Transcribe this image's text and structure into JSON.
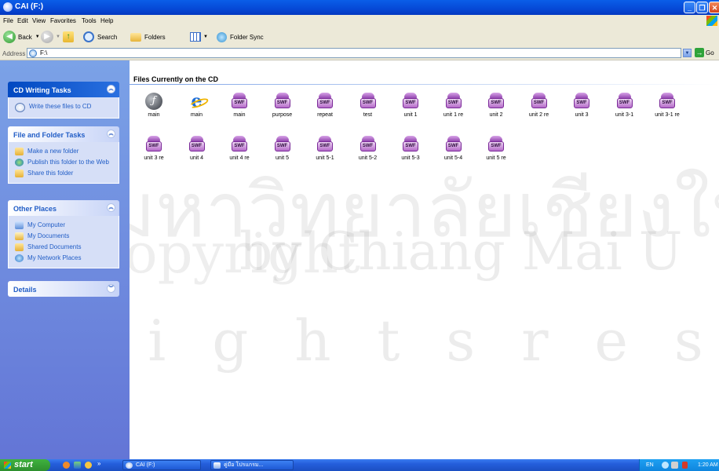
{
  "window": {
    "title": "CAI (F:)"
  },
  "menu": [
    "File",
    "Edit",
    "View",
    "Favorites",
    "Tools",
    "Help"
  ],
  "toolbar": {
    "back": "Back",
    "search": "Search",
    "folders": "Folders",
    "folder_sync": "Folder Sync"
  },
  "address": {
    "label": "Address",
    "value": "F:\\",
    "go": "Go"
  },
  "tasks": {
    "cd": {
      "title": "CD Writing Tasks",
      "items": [
        "Write these files to CD"
      ]
    },
    "file": {
      "title": "File and Folder Tasks",
      "items": [
        "Make a new folder",
        "Publish this folder to the Web",
        "Share this folder"
      ]
    },
    "places": {
      "title": "Other Places",
      "items": [
        "My Computer",
        "My Documents",
        "Shared Documents",
        "My Network Places"
      ]
    },
    "details": {
      "title": "Details"
    }
  },
  "content": {
    "section_title": "Files Currently on the CD",
    "files": [
      {
        "name": "main",
        "icon": "flash-icon"
      },
      {
        "name": "main",
        "icon": "ie-icon"
      },
      {
        "name": "main",
        "icon": "swf-icon"
      },
      {
        "name": "purpose",
        "icon": "swf-icon"
      },
      {
        "name": "repeat",
        "icon": "swf-icon"
      },
      {
        "name": "test",
        "icon": "swf-icon"
      },
      {
        "name": "unit 1",
        "icon": "swf-icon"
      },
      {
        "name": "unit 1 re",
        "icon": "swf-icon"
      },
      {
        "name": "unit 2",
        "icon": "swf-icon"
      },
      {
        "name": "unit 2 re",
        "icon": "swf-icon"
      },
      {
        "name": "unit 3",
        "icon": "swf-icon"
      },
      {
        "name": "unit 3-1",
        "icon": "swf-icon"
      },
      {
        "name": "unit 3-1 re",
        "icon": "swf-icon"
      },
      {
        "name": "unit 3 re",
        "icon": "swf-icon"
      },
      {
        "name": "unit 4",
        "icon": "swf-icon"
      },
      {
        "name": "unit 4 re",
        "icon": "swf-icon"
      },
      {
        "name": "unit 5",
        "icon": "swf-icon"
      },
      {
        "name": "unit 5-1",
        "icon": "swf-icon"
      },
      {
        "name": "unit 5-2",
        "icon": "swf-icon"
      },
      {
        "name": "unit 5-3",
        "icon": "swf-icon"
      },
      {
        "name": "unit 5-4",
        "icon": "swf-icon"
      },
      {
        "name": "unit 5 re",
        "icon": "swf-icon"
      }
    ],
    "swf_tag": "SWF"
  },
  "watermark": {
    "line1": "มหาวิทยาลัยเชียงใหม่",
    "line2": "Copyright",
    "line3": "by Chiang Mai U",
    "line4": "r i g h t s   r e s e"
  },
  "taskbar": {
    "start": "start",
    "windows": [
      "CAI (F:)",
      "คู่มือ โปรแกรม..."
    ],
    "tray_lang": "EN",
    "clock": "1:20 AM"
  }
}
